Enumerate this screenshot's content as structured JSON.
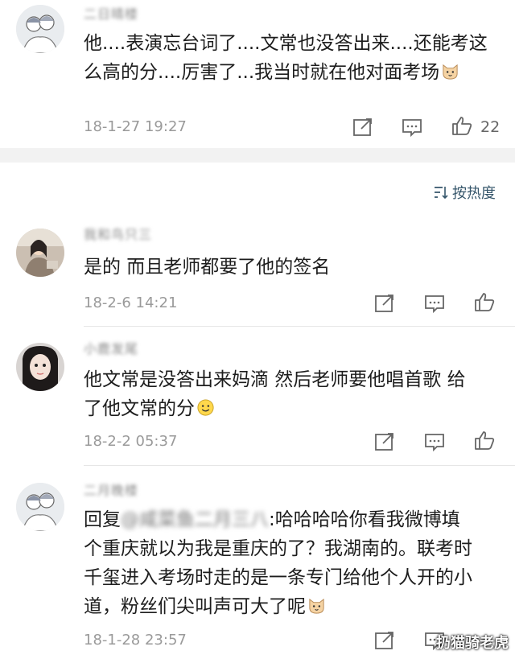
{
  "comments": [
    {
      "username": "二日晴楼",
      "text_lines": [
        "他....表演忘台词了....文常也没答出来....还能考这",
        "么高的分....厉害了...我当时就在他对面考场"
      ],
      "emoji": "cat-face",
      "time": "18-1-27 19:27",
      "likes": "22"
    },
    {
      "username": "我和鸟只三",
      "text_lines": [
        "是的 而且老师都要了他的签名"
      ],
      "time": "18-2-6 14:21"
    },
    {
      "username": "小鹿发尾",
      "text_lines": [
        "他文常是没答出来妈滴 然后老师要他唱首歌 给",
        "了他文常的分"
      ],
      "emoji": "smile",
      "time": "18-2-2 05:37"
    },
    {
      "username": "二月晚楼",
      "reply_prefix": "回复",
      "reply_target": "@咸菜鱼二月三八",
      "text_lines": [
        ":哈哈哈哈你看我微博填",
        "个重庆就以为我是重庆的了？我湖南的。联考时",
        "千玺进入考场时走的是一条专门给他个人开的小",
        "道，粉丝们尖叫声可大了呢"
      ],
      "emoji": "cat-face",
      "time": "18-1-28 23:57"
    }
  ],
  "sort": {
    "label": "按热度",
    "icon": "sort-icon"
  },
  "watermark": "扔猫骑老虎",
  "colors": {
    "accent": "#36566b",
    "meta": "#9a9a9a"
  }
}
